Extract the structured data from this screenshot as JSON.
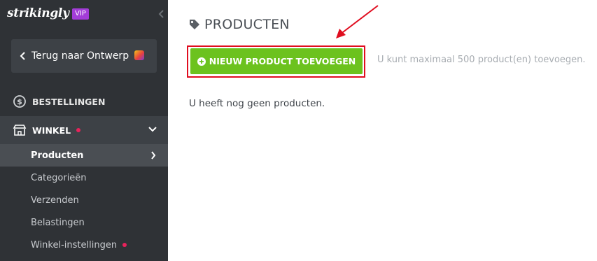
{
  "brand": {
    "name": "strikingly",
    "badge": "VIP"
  },
  "sidebar": {
    "back_label": "Terug naar Ontwerp",
    "orders_label": "BESTELLINGEN",
    "store_label": "WINKEL",
    "sub_items": [
      {
        "label": "Producten"
      },
      {
        "label": "Categorieën"
      },
      {
        "label": "Verzenden"
      },
      {
        "label": "Belastingen"
      },
      {
        "label": "Winkel-instellingen"
      }
    ]
  },
  "main": {
    "title": "PRODUCTEN",
    "add_button_label": "NIEUW PRODUCT TOEVOEGEN",
    "limit_text": "U kunt maximaal 500 product(en) toevoegen.",
    "empty_text": "U heeft nog geen producten."
  },
  "colors": {
    "sidebar_bg": "#2f3236",
    "accent_green": "#6cc21e",
    "vip_purple": "#a33dd8",
    "notification_dot": "#e8225b",
    "annotation_red": "#e00d1f"
  }
}
